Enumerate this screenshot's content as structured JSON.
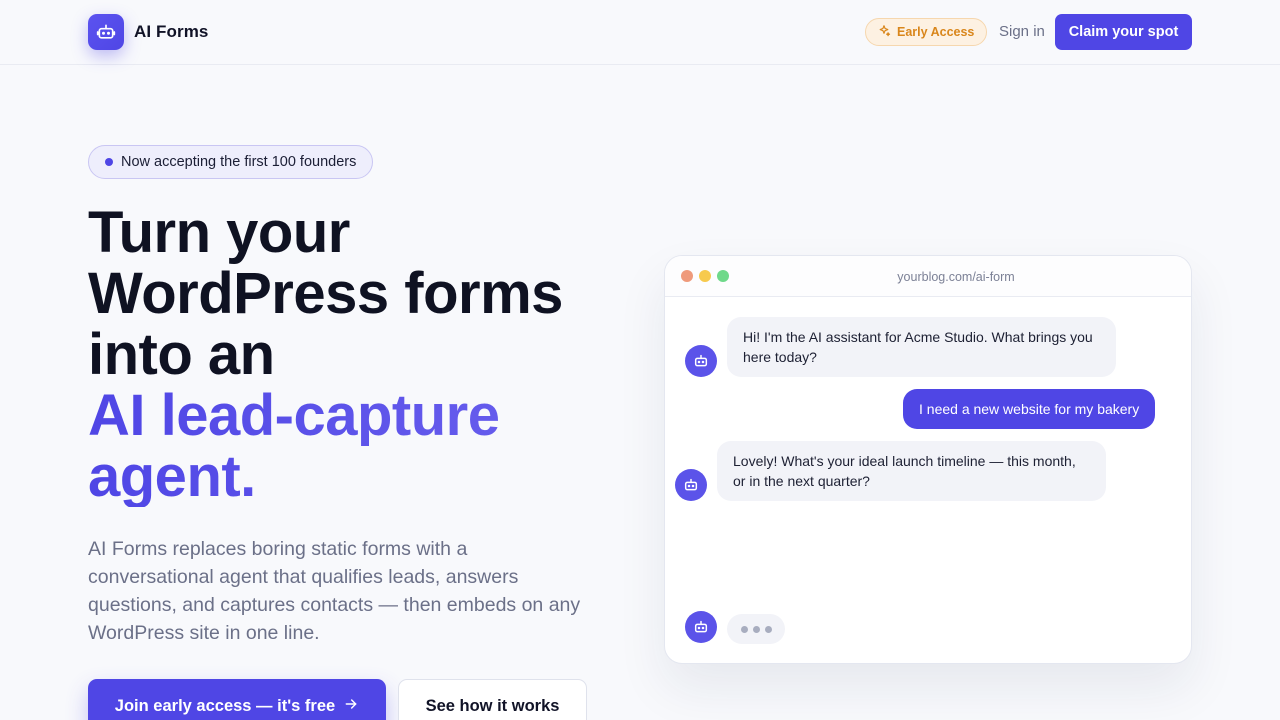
{
  "header": {
    "brand_name": "AI Forms",
    "early_access_label": "Early Access",
    "signin_label": "Sign in",
    "claim_label": "Claim your spot"
  },
  "hero": {
    "pill_text": "Now accepting the first 100 founders",
    "headline_lines": [
      "Turn your",
      "WordPress forms",
      "into an"
    ],
    "headline_accent_lines": [
      "AI lead-capture",
      "agent."
    ],
    "subtext": "AI Forms replaces boring static forms with a conversational agent that qualifies leads, answers questions, and captures contacts — then embeds on any WordPress site in one line.",
    "cta_primary_label": "Join early access — it's free",
    "cta_secondary_label": "See how it works"
  },
  "mock": {
    "url": "yourblog.com/ai-form",
    "messages": [
      {
        "from": "bot",
        "text": "Hi!    I'm the AI assistant for Acme Studio. What brings you here today?"
      },
      {
        "from": "user",
        "text": "I need a new website for my bakery"
      },
      {
        "from": "bot",
        "text": "Lovely! What's your ideal launch timeline — this month, or in the next quarter?"
      }
    ]
  },
  "colors": {
    "accent": "#4f46e5",
    "badge_text": "#d9861b",
    "muted_text": "#6b7088"
  },
  "icons": {
    "brand": "robot-icon",
    "early_access": "sparkle-icon",
    "cta_arrow": "arrow-right-icon",
    "bot_avatar": "robot-icon"
  }
}
